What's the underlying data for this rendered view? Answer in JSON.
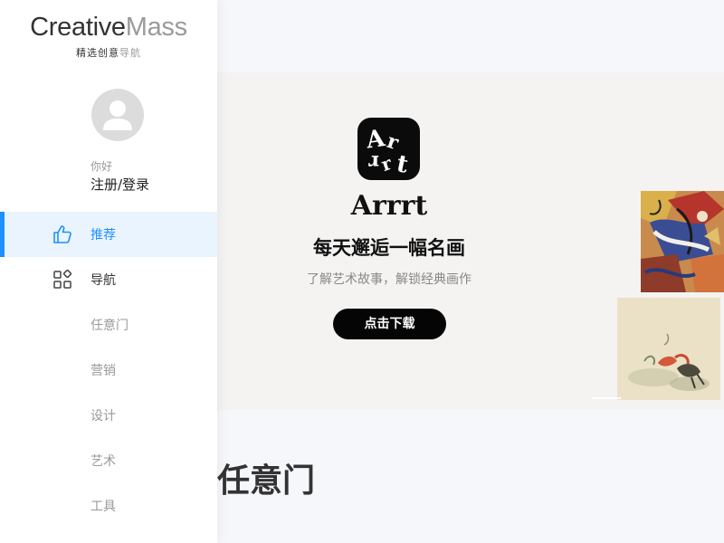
{
  "brand": {
    "name_part1": "Creative",
    "name_part2": "Mass",
    "tagline_part1": "精选创意",
    "tagline_part2": "导航"
  },
  "user": {
    "greeting": "你好",
    "login_label": "注册/登录"
  },
  "sidebar": {
    "items": [
      {
        "label": "推荐",
        "icon": "thumbs-up-icon",
        "active": true
      },
      {
        "label": "导航",
        "icon": "grid-icon",
        "active": false
      },
      {
        "label": "任意门",
        "active": false
      },
      {
        "label": "营销",
        "active": false
      },
      {
        "label": "设计",
        "active": false
      },
      {
        "label": "艺术",
        "active": false
      },
      {
        "label": "工具",
        "active": false
      }
    ]
  },
  "banner": {
    "app_name": "Arrrt",
    "app_icon_text": "Arrrt",
    "headline": "每天邂逅一幅名画",
    "subtitle": "了解艺术故事，解锁经典画作",
    "download_label": "点击下载"
  },
  "section": {
    "title": "任意门"
  },
  "colors": {
    "accent": "#1e90ff",
    "active_bg": "#e9f4fe",
    "banner_bg": "#f4f3f2",
    "button_bg": "#050505"
  }
}
